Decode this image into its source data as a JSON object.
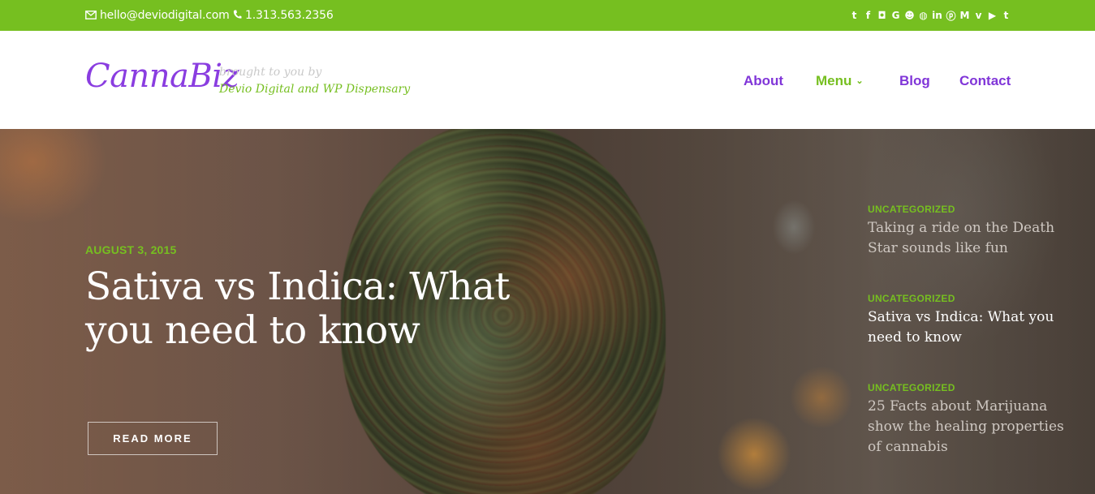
{
  "topbar": {
    "email": "hello@deviodigital.com",
    "phone": "1.313.563.2356",
    "social_icons": [
      {
        "name": "twitter-icon",
        "glyph": "t"
      },
      {
        "name": "facebook-icon",
        "glyph": "f"
      },
      {
        "name": "instagram-icon",
        "glyph": "◘"
      },
      {
        "name": "google-icon",
        "glyph": "G"
      },
      {
        "name": "snapchat-icon",
        "glyph": "☻"
      },
      {
        "name": "github-icon",
        "glyph": "◍"
      },
      {
        "name": "linkedin-icon",
        "glyph": "in"
      },
      {
        "name": "pinterest-icon",
        "glyph": "ⓟ"
      },
      {
        "name": "medium-icon",
        "glyph": "M"
      },
      {
        "name": "vine-icon",
        "glyph": "v"
      },
      {
        "name": "youtube-icon",
        "glyph": "▶"
      },
      {
        "name": "tumblr-icon",
        "glyph": "t"
      }
    ]
  },
  "header": {
    "logo": "CannaBiz",
    "brought": "brought to you by",
    "byline": "Devio Digital and WP Dispensary",
    "nav": {
      "about": "About",
      "menu": "Menu",
      "blog": "Blog",
      "contact": "Contact"
    }
  },
  "hero": {
    "date": "AUGUST 3, 2015",
    "title": "Sativa vs Indica: What you need to know",
    "read_more": "READ MORE"
  },
  "sidebar": {
    "posts": [
      {
        "category": "UNCATEGORIZED",
        "title": "Taking a ride on the Death Star sounds like fun"
      },
      {
        "category": "UNCATEGORIZED",
        "title": "Sativa vs Indica: What you need to know"
      },
      {
        "category": "UNCATEGORIZED",
        "title": "25 Facts about Marijuana show the healing properties of cannabis"
      }
    ]
  },
  "colors": {
    "accent_green": "#76bf20",
    "brand_purple": "#8035d8"
  }
}
